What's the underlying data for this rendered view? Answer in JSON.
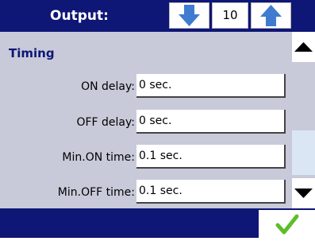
{
  "header": {
    "title": "Output:",
    "counter": "10",
    "down_icon": "arrow-down-icon",
    "up_icon": "arrow-up-icon"
  },
  "section": {
    "title": "Timing"
  },
  "rows": [
    {
      "label": "ON  delay:",
      "value": "0 sec."
    },
    {
      "label": "OFF delay:",
      "value": "0 sec."
    },
    {
      "label": "Min.ON time:",
      "value": "0.1 sec."
    },
    {
      "label": "Min.OFF time:",
      "value": "0.1 sec."
    }
  ],
  "scrollbar": {
    "up_icon": "triangle-up-icon",
    "down_icon": "triangle-down-icon"
  },
  "footer": {
    "confirm_icon": "checkmark-icon"
  },
  "colors": {
    "header_bg": "#0e1676",
    "panel_bg": "#c8cad9",
    "arrow_blue": "#3f7bd0",
    "check_green": "#5cbf2a"
  }
}
